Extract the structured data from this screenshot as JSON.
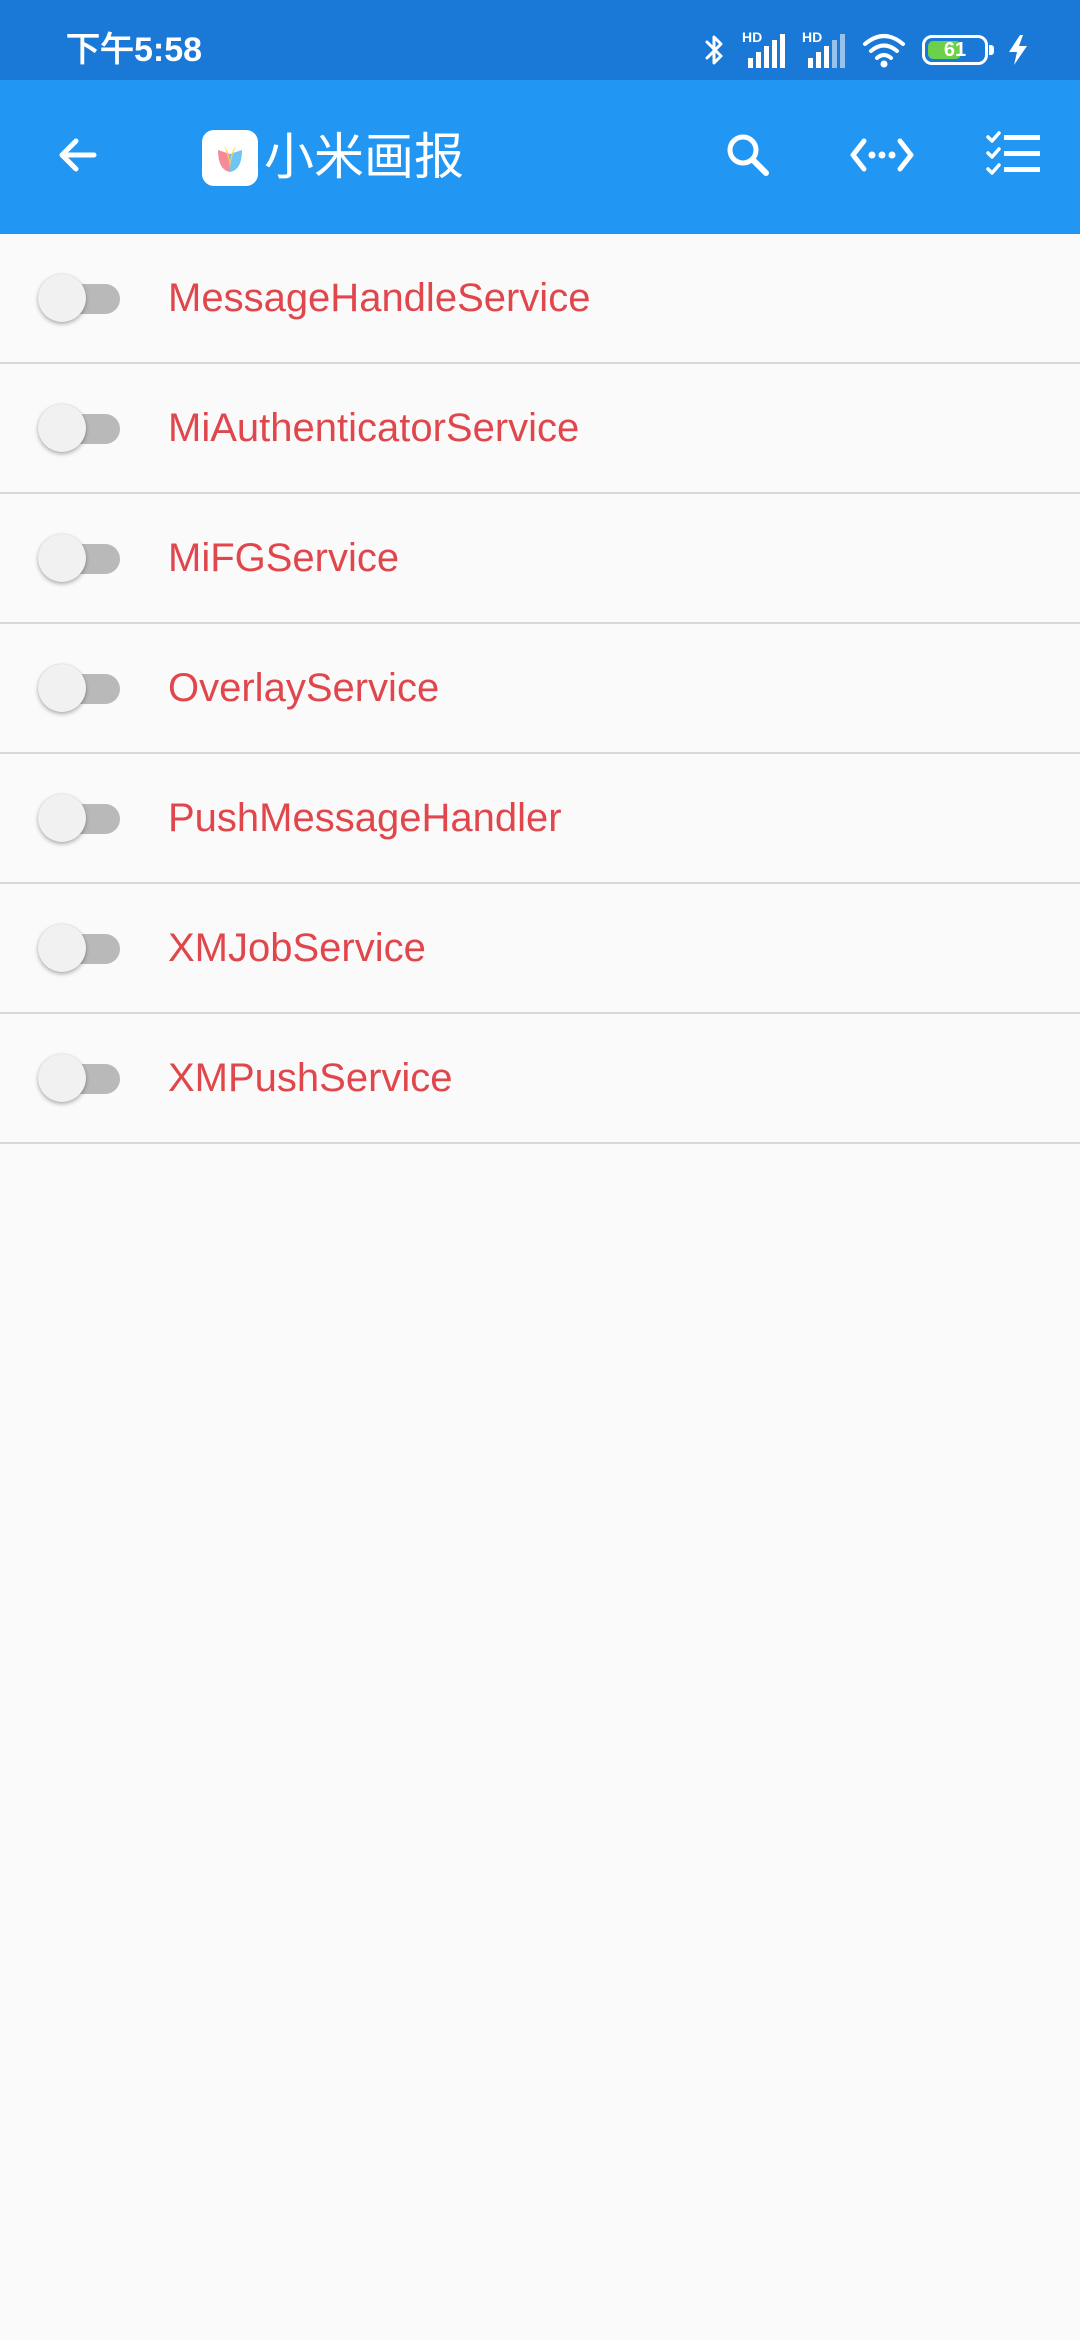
{
  "status_bar": {
    "time": "下午5:58",
    "battery_level": "61",
    "battery_level_percent": 61,
    "icons": [
      "bluetooth-icon",
      "hd-signal-icon",
      "hd-signal-icon",
      "wifi-icon",
      "battery-icon",
      "charging-icon"
    ],
    "signal_label": "HD"
  },
  "toolbar": {
    "title": "小米画报",
    "icons": [
      "back-arrow-icon",
      "app-icon",
      "search-icon",
      "code-icon",
      "checklist-icon"
    ]
  },
  "colors": {
    "status_bar": "#1a78d6",
    "toolbar": "#2196f3",
    "service_name": "#e0474c",
    "background": "#fbfafb",
    "divider": "#d9d8da"
  },
  "services": [
    {
      "name": "MessageHandleService",
      "enabled": false
    },
    {
      "name": "MiAuthenticatorService",
      "enabled": false
    },
    {
      "name": "MiFGService",
      "enabled": false
    },
    {
      "name": "OverlayService",
      "enabled": false
    },
    {
      "name": "PushMessageHandler",
      "enabled": false
    },
    {
      "name": "XMJobService",
      "enabled": false
    },
    {
      "name": "XMPushService",
      "enabled": false
    }
  ]
}
